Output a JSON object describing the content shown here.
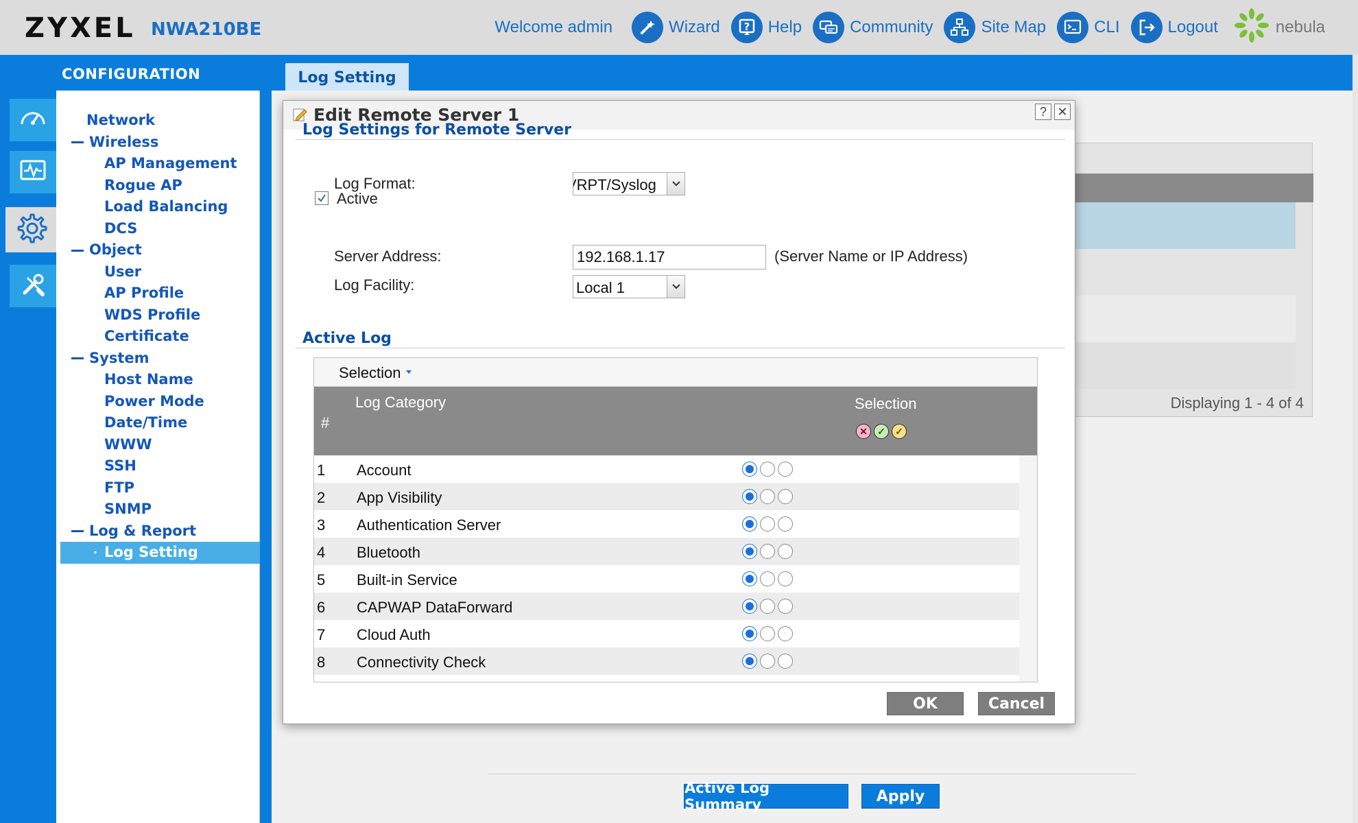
{
  "header": {
    "brand": "ZYXEL",
    "model": "NWA210BE",
    "welcome": "Welcome admin",
    "nav": [
      {
        "label": "Wizard",
        "icon": "wizard-icon"
      },
      {
        "label": "Help",
        "icon": "help-icon"
      },
      {
        "label": "Community",
        "icon": "community-icon"
      },
      {
        "label": "Site Map",
        "icon": "sitemap-icon"
      },
      {
        "label": "CLI",
        "icon": "cli-icon"
      },
      {
        "label": "Logout",
        "icon": "logout-icon"
      }
    ],
    "nebula": "nebula"
  },
  "sidebar": {
    "section_title": "CONFIGURATION",
    "menu": [
      {
        "label": "Network",
        "level": 0,
        "dash": false
      },
      {
        "label": "Wireless",
        "level": 0,
        "dash": true
      },
      {
        "label": "AP Management",
        "level": 1
      },
      {
        "label": "Rogue AP",
        "level": 1
      },
      {
        "label": "Load Balancing",
        "level": 1
      },
      {
        "label": "DCS",
        "level": 1
      },
      {
        "label": "Object",
        "level": 0,
        "dash": true
      },
      {
        "label": "User",
        "level": 1
      },
      {
        "label": "AP Profile",
        "level": 1
      },
      {
        "label": "WDS Profile",
        "level": 1
      },
      {
        "label": "Certificate",
        "level": 1
      },
      {
        "label": "System",
        "level": 0,
        "dash": true
      },
      {
        "label": "Host Name",
        "level": 1
      },
      {
        "label": "Power Mode",
        "level": 1
      },
      {
        "label": "Date/Time",
        "level": 1
      },
      {
        "label": "WWW",
        "level": 1
      },
      {
        "label": "SSH",
        "level": 1
      },
      {
        "label": "FTP",
        "level": 1
      },
      {
        "label": "SNMP",
        "level": 1
      },
      {
        "label": "Log & Report",
        "level": 0,
        "dash": true
      },
      {
        "label": "Log Setting",
        "level": 1,
        "selected": true
      }
    ]
  },
  "tab": {
    "label": "Log Setting"
  },
  "background": {
    "display_text": "Displaying 1 - 4 of 4",
    "summary_button": "Active Log Summary",
    "apply_button": "Apply"
  },
  "modal": {
    "title": "Edit Remote Server 1",
    "help_btn": "?",
    "close_btn": "✕",
    "section1": "Log Settings for Remote Server",
    "active_label": "Active",
    "active_checked": true,
    "log_format_label": "Log Format:",
    "log_format_value": "VRPT/Syslog",
    "server_address_label": "Server Address:",
    "server_address_value": "192.168.1.17",
    "server_address_hint": "(Server Name or IP Address)",
    "log_facility_label": "Log Facility:",
    "log_facility_value": "Local 1",
    "section2": "Active Log",
    "grid": {
      "toolbar_label": "Selection",
      "col_num": "#",
      "col_category": "Log Category",
      "col_selection": "Selection",
      "rows": [
        {
          "num": "1",
          "category": "Account",
          "selected": 0
        },
        {
          "num": "2",
          "category": "App Visibility",
          "selected": 0
        },
        {
          "num": "3",
          "category": "Authentication Server",
          "selected": 0
        },
        {
          "num": "4",
          "category": "Bluetooth",
          "selected": 0
        },
        {
          "num": "5",
          "category": "Built-in Service",
          "selected": 0
        },
        {
          "num": "6",
          "category": "CAPWAP DataForward",
          "selected": 0
        },
        {
          "num": "7",
          "category": "Cloud Auth",
          "selected": 0
        },
        {
          "num": "8",
          "category": "Connectivity Check",
          "selected": 0
        }
      ]
    },
    "ok_button": "OK",
    "cancel_button": "Cancel"
  },
  "colors": {
    "brand_blue": "#0a7ddc",
    "link_blue": "#1a6fc4",
    "menu_blue": "#1457b8",
    "section_blue": "#0b4fa3",
    "grid_header": "#8a8a8a",
    "radio_on": "#1a6fe0"
  }
}
